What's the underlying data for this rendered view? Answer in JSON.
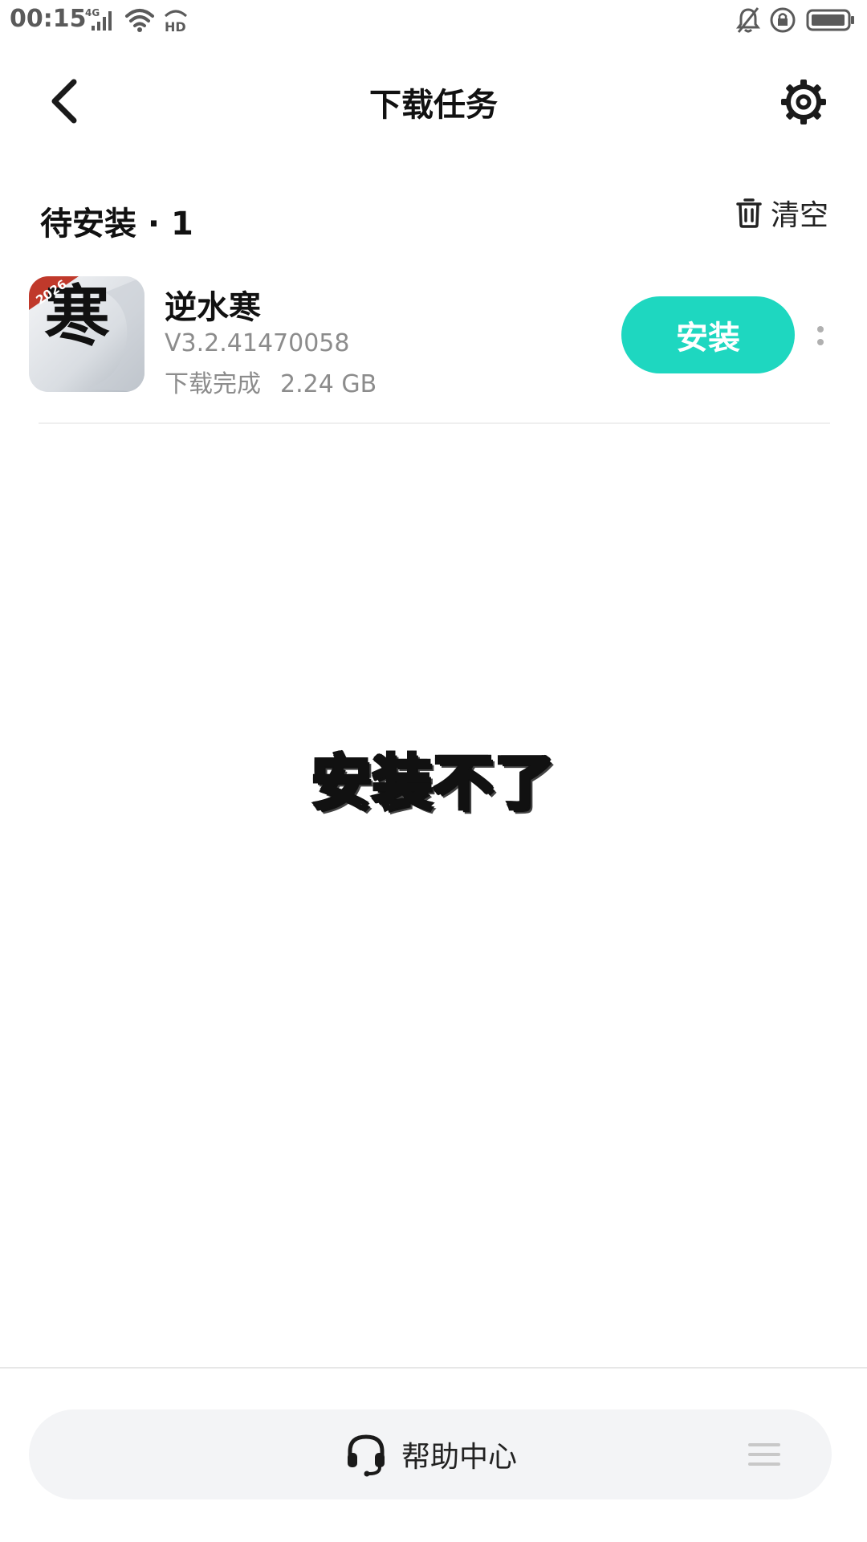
{
  "status_bar": {
    "time": "00:15",
    "network_label": "4G",
    "hd_label": "HD",
    "icons": [
      "signal-icon",
      "wifi-icon",
      "hd-icon",
      "bell-muted-icon",
      "rotation-lock-icon",
      "battery-icon"
    ]
  },
  "header": {
    "title": "下载任务",
    "back_icon": "chevron-left-icon",
    "settings_icon": "gear-icon"
  },
  "section": {
    "title": "待安装 · 1",
    "clear_label": "清空",
    "clear_icon": "trash-icon"
  },
  "downloads": [
    {
      "name": "逆水寒",
      "version": "V3.2.41470058",
      "status": "下载完成",
      "size": "2.24 GB",
      "icon_badge": "2026",
      "icon_glyph": "寒",
      "action_label": "安装"
    }
  ],
  "caption": "安装不了",
  "footer": {
    "help_label": "帮助中心",
    "help_icon": "headset-icon",
    "menu_icon": "menu-icon"
  },
  "colors": {
    "accent": "#1ed7c0",
    "badge_red": "#c0392b"
  }
}
